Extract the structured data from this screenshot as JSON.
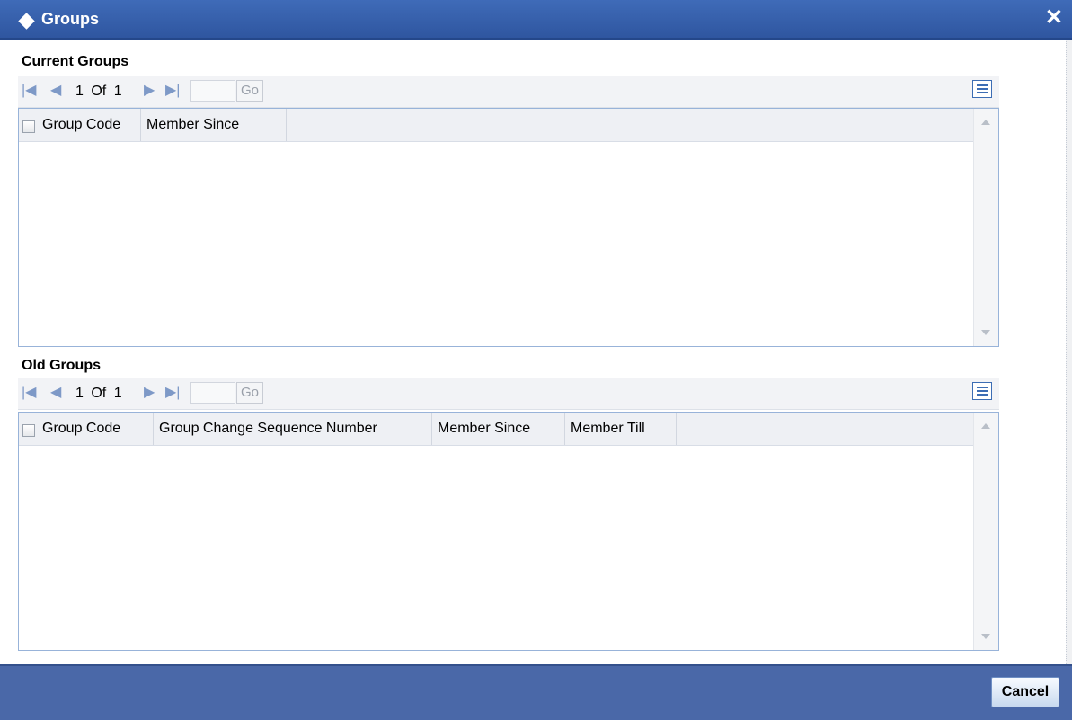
{
  "window": {
    "title": "Groups",
    "close_glyph": "✕"
  },
  "current_groups": {
    "label": "Current Groups",
    "pagination": {
      "current": "1",
      "of": "Of",
      "total": "1",
      "go_label": "Go",
      "page_input_value": ""
    },
    "columns": [
      "Group Code",
      "Member Since"
    ],
    "rows": []
  },
  "old_groups": {
    "label": "Old Groups",
    "pagination": {
      "current": "1",
      "of": "Of",
      "total": "1",
      "go_label": "Go",
      "page_input_value": ""
    },
    "columns": [
      "Group Code",
      "Group Change Sequence Number",
      "Member Since",
      "Member Till"
    ],
    "rows": []
  },
  "footer": {
    "cancel_label": "Cancel"
  },
  "icons": {
    "window": "diamond-icon",
    "close": "close-icon",
    "nav": [
      "first-page-icon",
      "prev-page-icon",
      "next-page-icon",
      "last-page-icon"
    ],
    "settings": "column-settings-icon"
  },
  "colors": {
    "titlebar": "#2f56a0",
    "footer": "#4a68a8",
    "border": "#98b3d9"
  }
}
